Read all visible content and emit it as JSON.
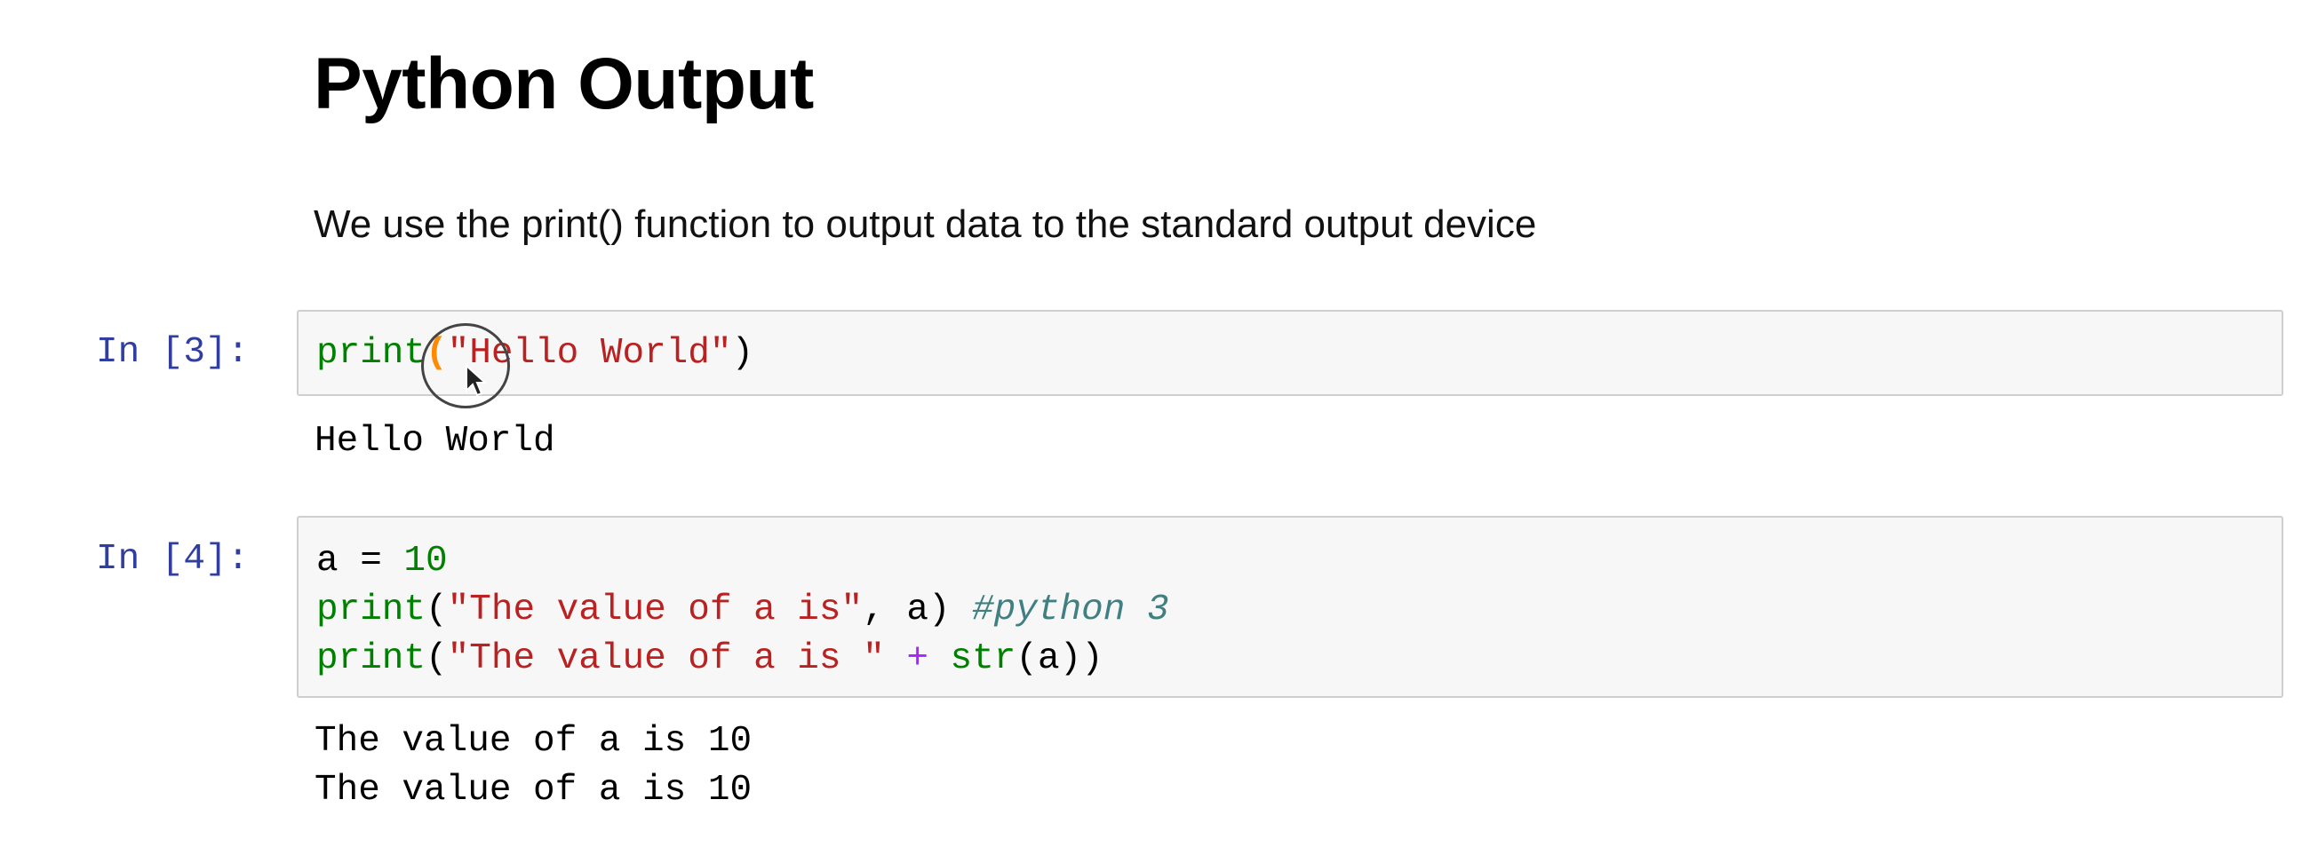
{
  "notebook": {
    "title": "Python Output",
    "description": "We use the print() function to output data to the standard output device",
    "cells": [
      {
        "prompt": "In [3]:",
        "code": {
          "line1": {
            "fn": "print",
            "open_paren": "(",
            "string": "\"Hello World\"",
            "close_paren": ")"
          }
        },
        "output": [
          "Hello World"
        ]
      },
      {
        "prompt": "In [4]:",
        "code": {
          "line1": {
            "var": "a",
            "eq": " = ",
            "num": "10"
          },
          "line2": {
            "fn": "print",
            "open": "(",
            "string": "\"The value of a is\"",
            "rest": ", a) ",
            "comment": "#python 3"
          },
          "line3": {
            "fn": "print",
            "open": "(",
            "string": "\"The value of a is \"",
            "plus": " + ",
            "fn2": "str",
            "rest": "(a))"
          }
        },
        "output": [
          "The value of a is 10",
          "The value of a is 10"
        ]
      }
    ]
  },
  "colors": {
    "prompt": "#303f9f",
    "builtin": "#008000",
    "string": "#ba2121",
    "operator": "#aa22ff",
    "comment": "#408080"
  },
  "cursor": {
    "icon": "mouse-pointer-icon"
  }
}
